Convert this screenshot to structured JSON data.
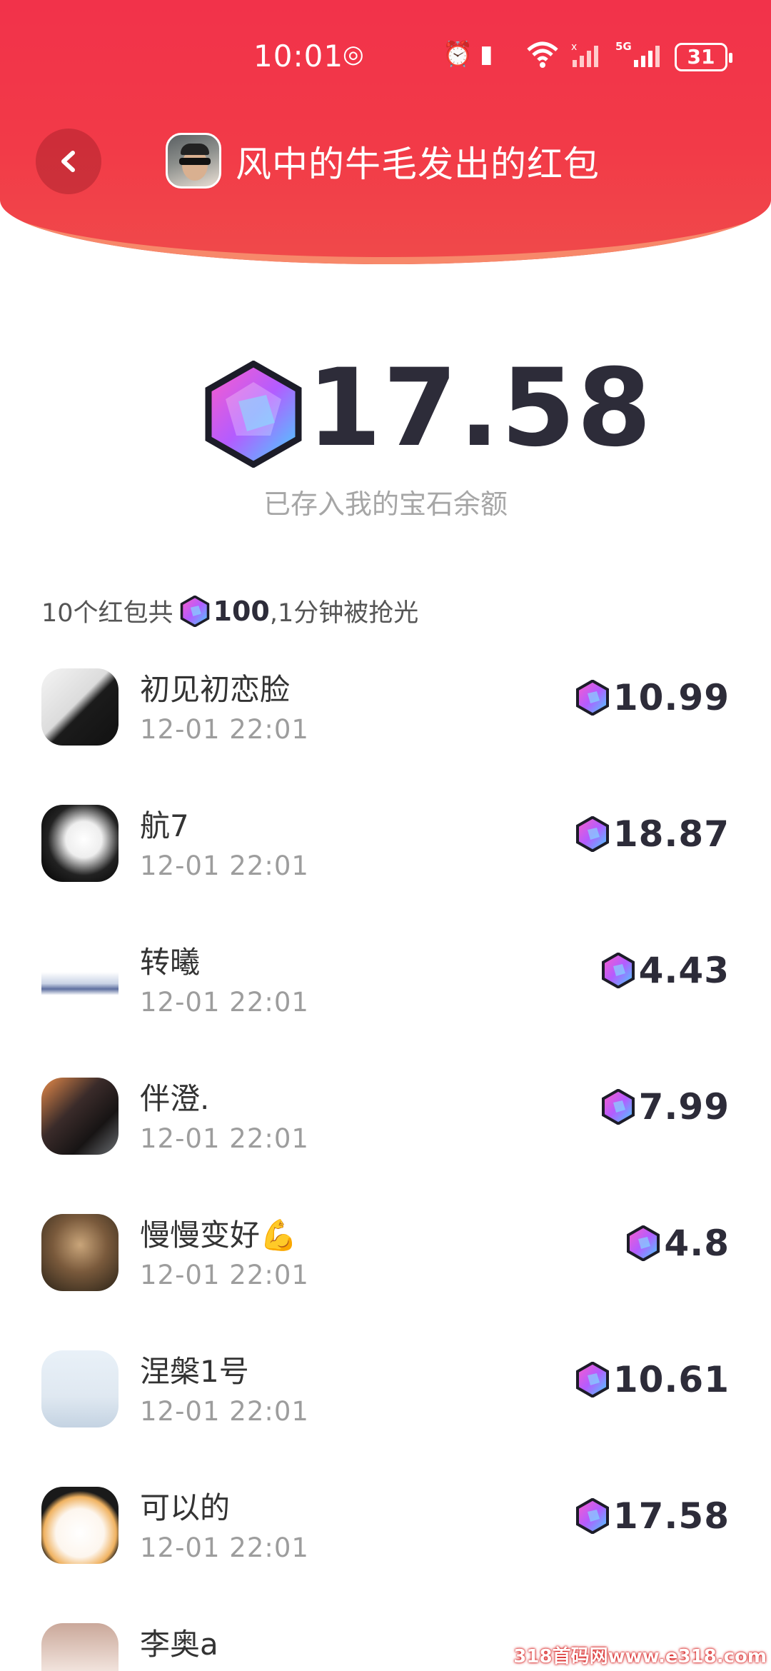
{
  "status_bar": {
    "time": "10:01",
    "battery": "31"
  },
  "header": {
    "title": "风中的牛毛发出的红包"
  },
  "balance": {
    "amount": "17.58",
    "note": "已存入我的宝石余额"
  },
  "summary": {
    "prefix": "10个红包共",
    "total": "100",
    "suffix": ",1分钟被抢光"
  },
  "records": [
    {
      "name": "初见初恋脸",
      "time": "12-01 22:01",
      "amount": "10.99"
    },
    {
      "name": "航7",
      "time": "12-01 22:01",
      "amount": "18.87"
    },
    {
      "name": "转曦",
      "time": "12-01 22:01",
      "amount": "4.43"
    },
    {
      "name": "伴澄.",
      "time": "12-01 22:01",
      "amount": "7.99"
    },
    {
      "name": "慢慢变好💪",
      "time": "12-01 22:01",
      "amount": "4.8"
    },
    {
      "name": "涅槃1号",
      "time": "12-01 22:01",
      "amount": "10.61"
    },
    {
      "name": "可以的",
      "time": "12-01 22:01",
      "amount": "17.58"
    },
    {
      "name": "李奥a",
      "time": "",
      "amount": ""
    }
  ],
  "watermark": "318首码网www.e318.com",
  "icons": {
    "back": "chevron-left-icon",
    "gem": "gem-icon",
    "alarm": "alarm-icon",
    "vibrate": "vibrate-icon",
    "wifi": "wifi-icon",
    "signal": "signal-icon"
  }
}
